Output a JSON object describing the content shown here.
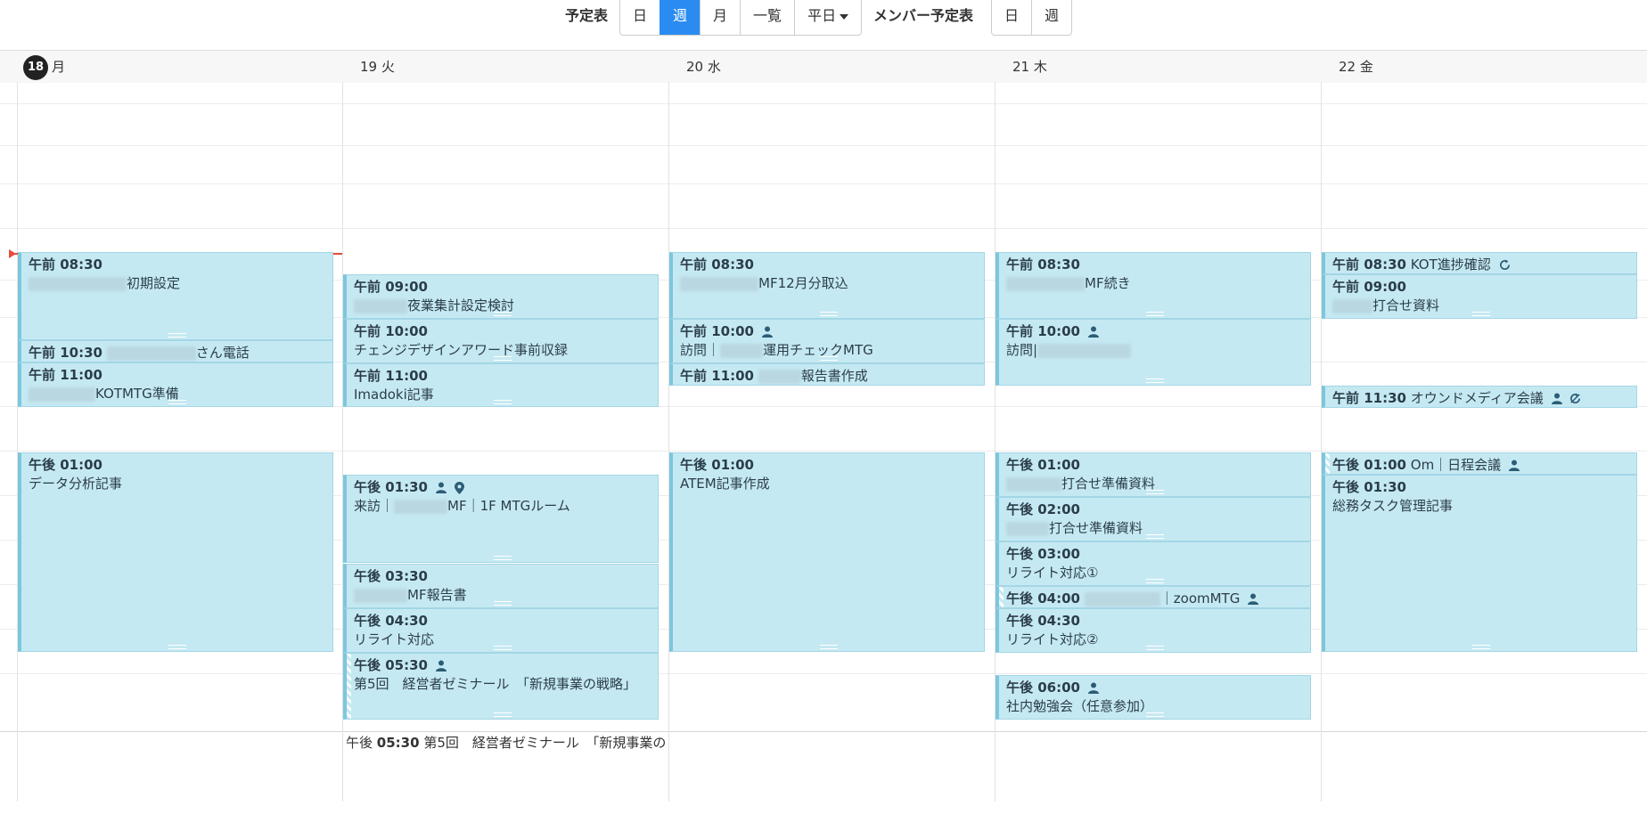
{
  "toolbar": {
    "schedule_label": "予定表",
    "view_buttons": [
      "日",
      "週",
      "月",
      "一覧",
      "平日"
    ],
    "active_view": "週",
    "member_label": "メンバー予定表",
    "member_buttons": [
      "日",
      "週"
    ]
  },
  "days": [
    {
      "num": "18",
      "dow": "月"
    },
    {
      "num": "19",
      "dow": "火"
    },
    {
      "num": "20",
      "dow": "水"
    },
    {
      "num": "21",
      "dow": "木"
    },
    {
      "num": "22",
      "dow": "金"
    }
  ],
  "events": {
    "mon": [
      {
        "time": "午前 08:30",
        "title": "初期設定"
      },
      {
        "time": "午前 10:30",
        "title": "さん電話"
      },
      {
        "time": "午前 11:00",
        "title": "KOTMTG準備"
      },
      {
        "time": "午後 01:00",
        "title": "データ分析記事"
      }
    ],
    "tue": [
      {
        "time": "午前 09:00",
        "title": "夜業集計設定検討"
      },
      {
        "time": "午前 10:00",
        "title": "チェンジデザインアワード事前収録"
      },
      {
        "time": "午前 11:00",
        "title": "Imadoki記事"
      },
      {
        "time": "午後 01:30",
        "title_a": "来訪｜",
        "title_b": "MF｜1F MTGルーム"
      },
      {
        "time": "午後 03:30",
        "title": "MF報告書"
      },
      {
        "time": "午後 04:30",
        "title": "リライト対応"
      },
      {
        "time": "午後 05:30",
        "title": "第5回　経営者ゼミナール　「新規事業の戦略」"
      }
    ],
    "wed": [
      {
        "time": "午前 08:30",
        "title": "MF12月分取込"
      },
      {
        "time": "午前 10:00",
        "title_a": "訪問｜",
        "title_b": "運用チェックMTG"
      },
      {
        "time": "午前 11:00",
        "title": "報告書作成"
      },
      {
        "time": "午後 01:00",
        "title": "ATEM記事作成"
      }
    ],
    "thu": [
      {
        "time": "午前 08:30",
        "title": "MF続き"
      },
      {
        "time": "午前 10:00",
        "title": "訪問|"
      },
      {
        "time": "午後 01:00",
        "title": "打合せ準備資料"
      },
      {
        "time": "午後 02:00",
        "title": "打合せ準備資料"
      },
      {
        "time": "午後 03:00",
        "title": "リライト対応①"
      },
      {
        "time": "午後 04:00",
        "title": "｜zoomMTG"
      },
      {
        "time": "午後 04:30",
        "title": "リライト対応②"
      },
      {
        "time": "午後 06:00",
        "title": "社内勉強会（任意参加）"
      }
    ],
    "fri": [
      {
        "time": "午前 08:30",
        "title": "KOT進捗確認"
      },
      {
        "time": "午前 09:00",
        "title": "打合せ資料"
      },
      {
        "time": "午前 11:30",
        "title": "オウンドメディア会議"
      },
      {
        "time": "午後 01:00",
        "title": "Om｜日程会議"
      },
      {
        "time": "午後 01:30",
        "title": "総務タスク管理記事"
      }
    ]
  },
  "bottom_event": {
    "prefix": "午後",
    "time": "05:30",
    "title": "第5回　経営者ゼミナール　「新規事業の"
  },
  "colors": {
    "event_bg": "#c5e9f2",
    "event_border": "#7cc7dd",
    "active_button": "#2a8cf0",
    "now_line": "#e84b3a"
  }
}
